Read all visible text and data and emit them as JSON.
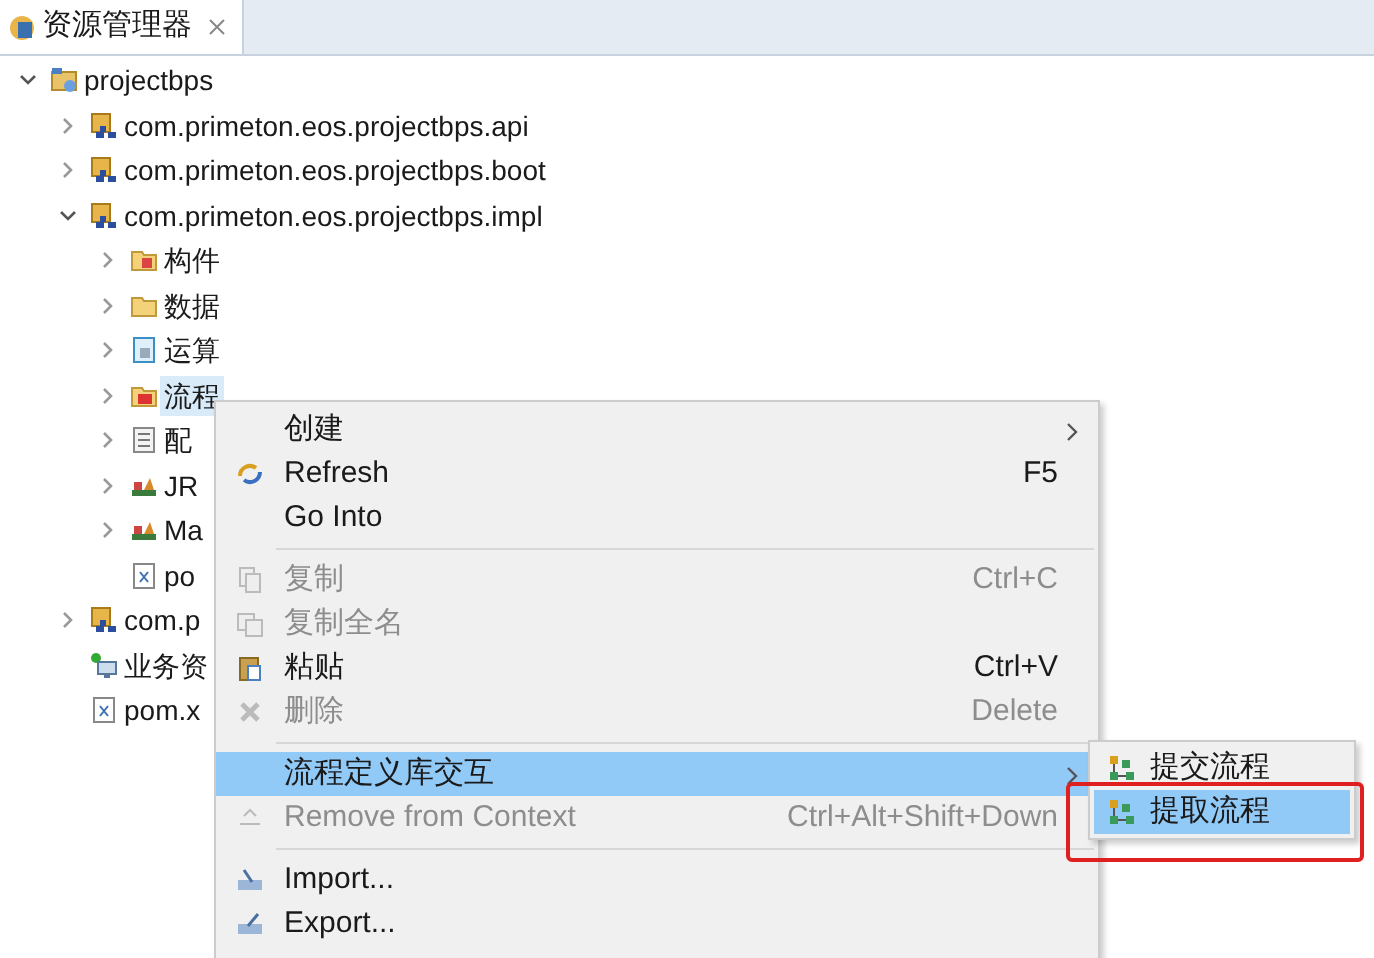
{
  "tab": {
    "title": "资源管理器",
    "selected": true
  },
  "tree": [
    {
      "label": "projectbps",
      "kind": "project",
      "expanded": true,
      "selected": false,
      "children": [
        {
          "label": "com.primeton.eos.projectbps.api",
          "kind": "module",
          "expanded": false,
          "selected": false
        },
        {
          "label": "com.primeton.eos.projectbps.boot",
          "kind": "module",
          "expanded": false,
          "selected": false
        },
        {
          "label": "com.primeton.eos.projectbps.impl",
          "kind": "module",
          "expanded": true,
          "selected": false,
          "children": [
            {
              "label": "构件",
              "kind": "component-folder",
              "expanded": false,
              "selected": false
            },
            {
              "label": "数据",
              "kind": "folder",
              "expanded": false,
              "selected": false
            },
            {
              "label": "运算",
              "kind": "logic",
              "expanded": false,
              "selected": false
            },
            {
              "label": "流程",
              "kind": "process-folder",
              "expanded": false,
              "selected": true
            },
            {
              "label": "配",
              "kind": "config",
              "expanded": false,
              "selected": false
            },
            {
              "label": "JR",
              "kind": "library",
              "expanded": false,
              "selected": false
            },
            {
              "label": "Ma",
              "kind": "library",
              "expanded": false,
              "selected": false
            },
            {
              "label": "po",
              "kind": "xml",
              "selected": false
            }
          ]
        },
        {
          "label": "com.p",
          "kind": "module",
          "expanded": false,
          "selected": false
        },
        {
          "label": "业务资",
          "kind": "service",
          "selected": false
        },
        {
          "label": "pom.x",
          "kind": "xml",
          "selected": false
        }
      ]
    }
  ],
  "context_menu": [
    {
      "kind": "item",
      "label": "创建",
      "submenu": true,
      "disabled": false,
      "selected": false
    },
    {
      "kind": "item",
      "label": "Refresh",
      "shortcut": "F5",
      "disabled": false,
      "selected": false
    },
    {
      "kind": "item",
      "label": "Go Into",
      "disabled": false,
      "selected": false
    },
    {
      "kind": "separator"
    },
    {
      "kind": "item",
      "label": "复制",
      "shortcut": "Ctrl+C",
      "disabled": true,
      "selected": false
    },
    {
      "kind": "item",
      "label": "复制全名",
      "disabled": true,
      "selected": false
    },
    {
      "kind": "item",
      "label": "粘贴",
      "shortcut": "Ctrl+V",
      "disabled": false,
      "selected": false
    },
    {
      "kind": "item",
      "label": "删除",
      "shortcut": "Delete",
      "disabled": true,
      "selected": false
    },
    {
      "kind": "separator"
    },
    {
      "kind": "item",
      "label": "流程定义库交互",
      "submenu": true,
      "disabled": false,
      "selected": true
    },
    {
      "kind": "item",
      "label": "Remove from Context",
      "shortcut": "Ctrl+Alt+Shift+Down",
      "disabled": true,
      "selected": false
    },
    {
      "kind": "separator"
    },
    {
      "kind": "item",
      "label": "Import...",
      "disabled": false,
      "selected": false
    },
    {
      "kind": "item",
      "label": "Export...",
      "disabled": false,
      "selected": false
    }
  ],
  "submenu": [
    {
      "label": "提交流程",
      "selected": false
    },
    {
      "label": "提取流程",
      "selected": true,
      "highlighted": true
    }
  ]
}
